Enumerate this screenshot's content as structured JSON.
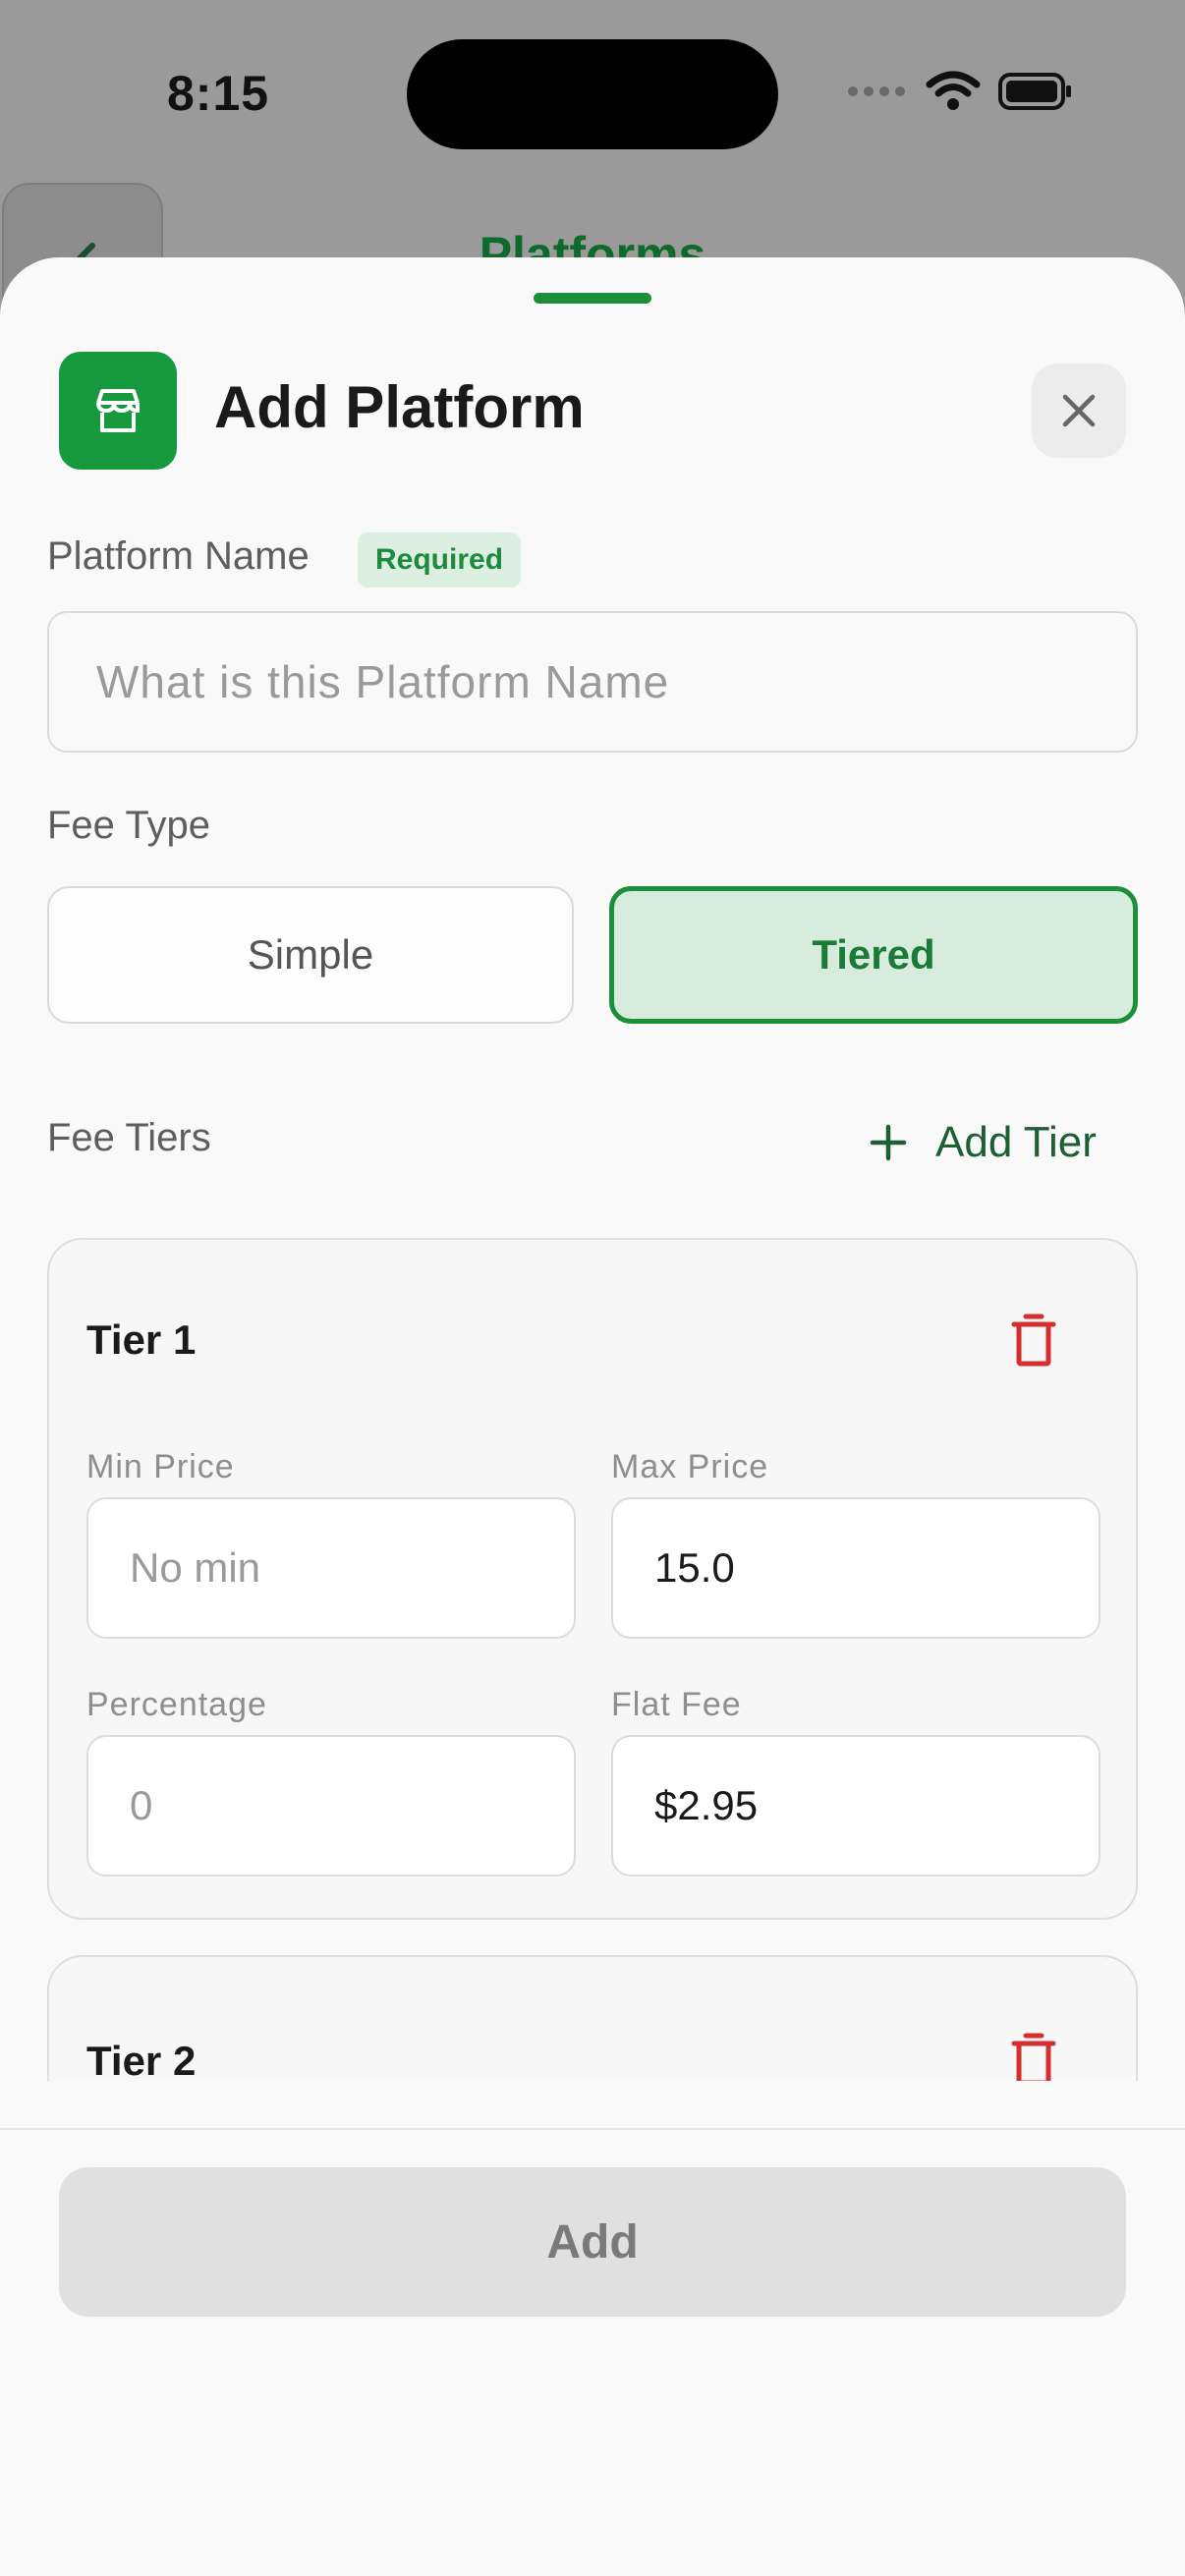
{
  "status_bar": {
    "time": "8:15"
  },
  "background_page": {
    "title": "Platforms"
  },
  "sheet": {
    "title": "Add Platform",
    "platform_name": {
      "label": "Platform Name",
      "badge": "Required",
      "placeholder": "What is this Platform Name",
      "value": ""
    },
    "fee_type": {
      "label": "Fee Type",
      "options": [
        "Simple",
        "Tiered"
      ],
      "selected": "Tiered"
    },
    "fee_tiers": {
      "label": "Fee Tiers",
      "add_label": "Add Tier",
      "tiers": [
        {
          "title": "Tier 1",
          "min_price": {
            "label": "Min Price",
            "placeholder": "No min",
            "value": ""
          },
          "max_price": {
            "label": "Max Price",
            "placeholder": "",
            "value": "15.0"
          },
          "percentage": {
            "label": "Percentage",
            "placeholder": "0",
            "value": ""
          },
          "flat_fee": {
            "label": "Flat Fee",
            "placeholder": "",
            "value": "$2.95"
          }
        },
        {
          "title": "Tier 2"
        }
      ]
    },
    "submit_label": "Add"
  },
  "colors": {
    "accent": "#1b8f3a",
    "accent_light": "#d8ecdd",
    "danger": "#d32f2f",
    "disabled_button": "#e0e0e0"
  },
  "icons": [
    "storefront-icon",
    "close-icon",
    "plus-icon",
    "trash-icon",
    "wifi-icon",
    "battery-icon",
    "cellular-icon",
    "back-chevron-icon"
  ]
}
